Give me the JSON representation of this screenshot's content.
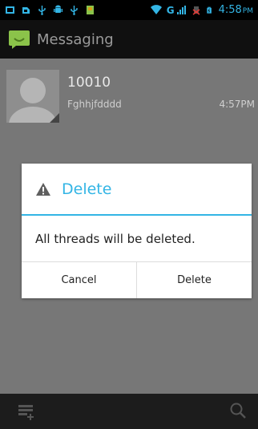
{
  "status_bar": {
    "time": "4:58",
    "ampm": "PM",
    "network": "G",
    "icons": [
      "notification-icon",
      "sim-card-icon",
      "usb-icon",
      "android-debug-icon",
      "usb-icon",
      "sd-card-icon",
      "wifi-icon",
      "signal-icon",
      "no-sim-icon",
      "battery-icon"
    ]
  },
  "action_bar": {
    "title": "Messaging",
    "icon": "messaging-app-icon"
  },
  "conversations": [
    {
      "number": "10010",
      "snippet": "Fghhjfdddd",
      "time": "4:57PM"
    }
  ],
  "dialog": {
    "title": "Delete",
    "message": "All threads will be deleted.",
    "cancel_label": "Cancel",
    "confirm_label": "Delete",
    "icon": "warning-icon"
  },
  "bottom_bar": {
    "compose_icon": "compose-icon",
    "search_icon": "search-icon"
  },
  "colors": {
    "accent": "#33b5e5",
    "dim_background": "#777777",
    "status_bar": "#000000"
  }
}
